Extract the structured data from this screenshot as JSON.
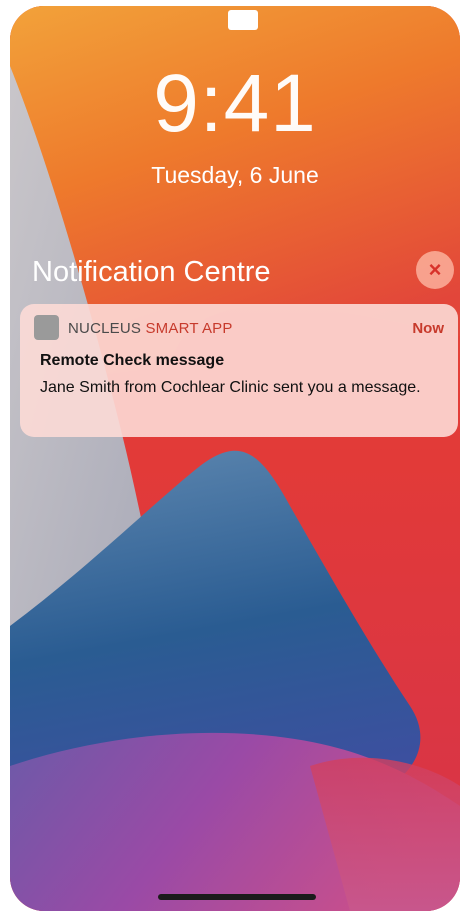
{
  "lock_screen": {
    "time": "9:41",
    "date": "Tuesday, 6 June"
  },
  "notification_centre": {
    "title": "Notification Centre",
    "close_icon": "×"
  },
  "notification": {
    "app_name_part1": "NUCLEUS",
    "app_name_part2": " SMART APP",
    "time": "Now",
    "title": "Remote Check message",
    "body": "Jane Smith from Cochlear Clinic sent you a message."
  },
  "colors": {
    "accent_red": "#c73a2c",
    "wallpaper_orange": "#f08a2a",
    "wallpaper_blue": "#1e4f88",
    "wallpaper_purple": "#8a3f9c"
  }
}
